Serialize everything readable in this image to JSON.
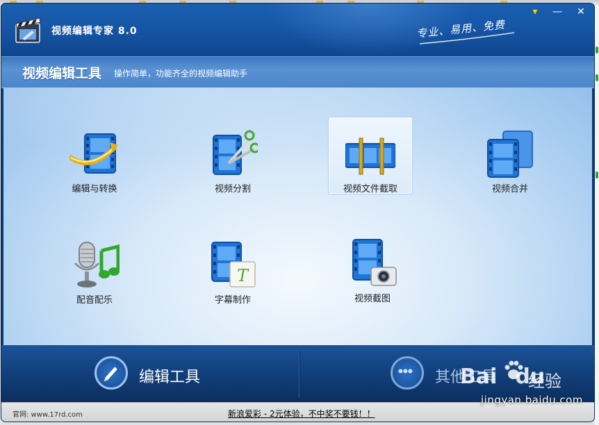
{
  "window": {
    "app_title": "视频编辑专家 8.0",
    "slogan": "专业、易用、免费",
    "controls": {
      "menu": "▾",
      "minimize": "—",
      "close": "✕"
    }
  },
  "header": {
    "title": "视频编辑工具",
    "subtitle": "操作简单，功能齐全的视频编辑助手"
  },
  "tools": [
    {
      "label": "编辑与转换",
      "icon": "film-convert-icon"
    },
    {
      "label": "视频分割",
      "icon": "film-scissors-icon"
    },
    {
      "label": "视频文件截取",
      "icon": "film-trim-icon",
      "selected": true
    },
    {
      "label": "视频合并",
      "icon": "film-merge-icon"
    },
    {
      "label": "配音配乐",
      "icon": "microphone-music-icon"
    },
    {
      "label": "字幕制作",
      "icon": "film-subtitle-icon"
    },
    {
      "label": "视频截图",
      "icon": "film-camera-icon"
    }
  ],
  "bottom_tabs": {
    "edit": "编辑工具",
    "other": "其他工具"
  },
  "statusbar": {
    "site": "官网: www.17rd.com",
    "promo": "新浪爱彩 - 2元体验，不中奖不要钱！！"
  },
  "watermark": {
    "brand": "Bai",
    "brand_du": "du",
    "suffix": "经验",
    "url": "jingyan.baidu.com"
  },
  "colors": {
    "titlebar": "#1656a6",
    "header_band": "#4b86cb",
    "bottom_bar": "#123f7a",
    "selected_tool": "#dcebfa"
  }
}
